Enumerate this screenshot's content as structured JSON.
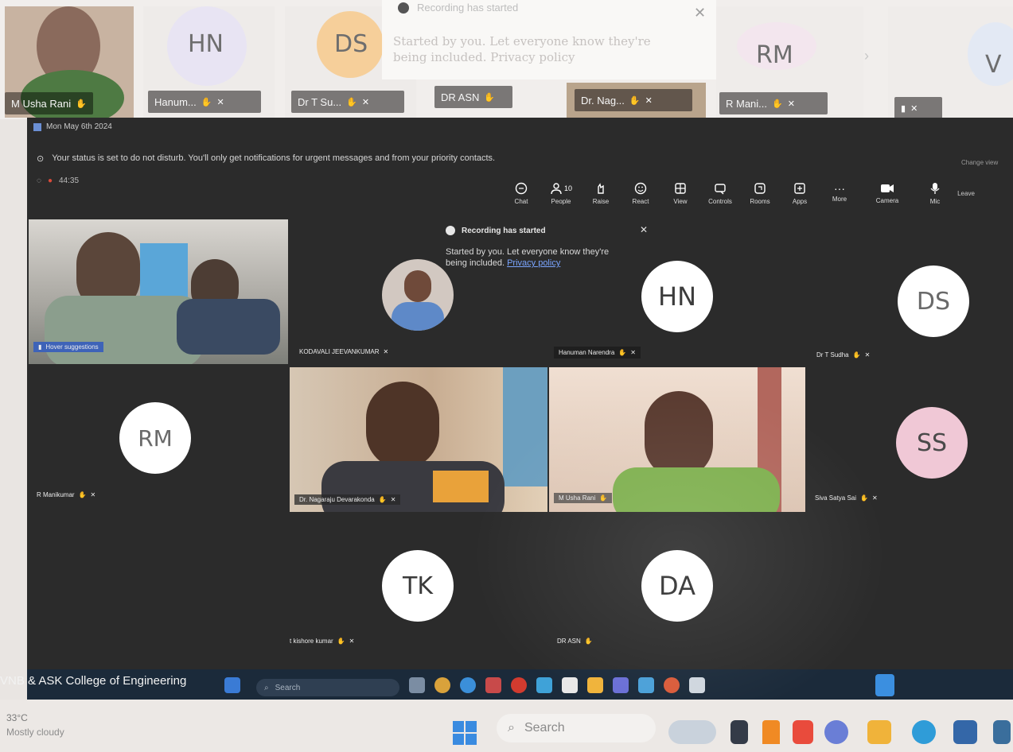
{
  "outer_strip": {
    "tiles": [
      {
        "name": "M Usha Rani",
        "initials": ""
      },
      {
        "name": "Hanum...",
        "initials": "HN"
      },
      {
        "name": "Dr T Su...",
        "initials": "DS"
      },
      {
        "name": "DR ASN",
        "initials": ""
      },
      {
        "name": "Dr. Nag...",
        "initials": ""
      },
      {
        "name": "R Mani...",
        "initials": "RM"
      },
      {
        "name": "",
        "initials": "V"
      }
    ],
    "popup": {
      "title": "Recording has started",
      "body": "Started by you. Let everyone know they're being included. Privacy policy"
    }
  },
  "window": {
    "date_bar": "Mon May 6th 2024",
    "notification": "Your status is set to do not disturb. You'll only get notifications for urgent messages and from your priority contacts.",
    "timer": "44:35",
    "toolbar": [
      {
        "label": "Chat",
        "icon": "chat-icon"
      },
      {
        "label": "People",
        "icon": "people-icon",
        "count": "10"
      },
      {
        "label": "Raise",
        "icon": "raise-hand-icon"
      },
      {
        "label": "React",
        "icon": "react-icon"
      },
      {
        "label": "View",
        "icon": "view-icon"
      },
      {
        "label": "Controls",
        "icon": "controls-icon"
      },
      {
        "label": "Rooms",
        "icon": "rooms-icon"
      },
      {
        "label": "Apps",
        "icon": "apps-icon"
      },
      {
        "label": "More",
        "icon": "more-icon"
      },
      {
        "label": "Camera",
        "icon": "camera-icon"
      },
      {
        "label": "Mic",
        "icon": "mic-icon"
      }
    ],
    "leave_label": "Leave",
    "side_hint": "Change view",
    "popup": {
      "title": "Recording has started",
      "body": "Started by you. Let everyone know they're being included.",
      "link": "Privacy policy"
    },
    "tiles": [
      {
        "name": "Hover suggestions",
        "initials": ""
      },
      {
        "name": "KODAVALI JEEVANKUMAR",
        "initials": ""
      },
      {
        "name": "Hanuman Narendra",
        "initials": "HN"
      },
      {
        "name": "Dr T Sudha",
        "initials": "DS"
      },
      {
        "name": "R Manikumar",
        "initials": "RM"
      },
      {
        "name": "Dr. Nagaraju Devarakonda",
        "initials": ""
      },
      {
        "name": "M Usha Rani",
        "initials": ""
      },
      {
        "name": "Siva Satya Sai",
        "initials": "SS"
      },
      {
        "name": "t kishore kumar",
        "initials": "TK"
      },
      {
        "name": "DR ASN",
        "initials": "DA"
      }
    ],
    "taskbar": {
      "college": "VNB & ASK College of Engineering",
      "search": "Search"
    }
  },
  "outer_taskbar": {
    "temperature": "33°C",
    "weather": "Mostly cloudy",
    "search": "Search"
  },
  "colors": {
    "teams_bg": "#2b2b2b",
    "avatar_ss": "#f0c8d6",
    "avatar_default": "#ffffff"
  }
}
